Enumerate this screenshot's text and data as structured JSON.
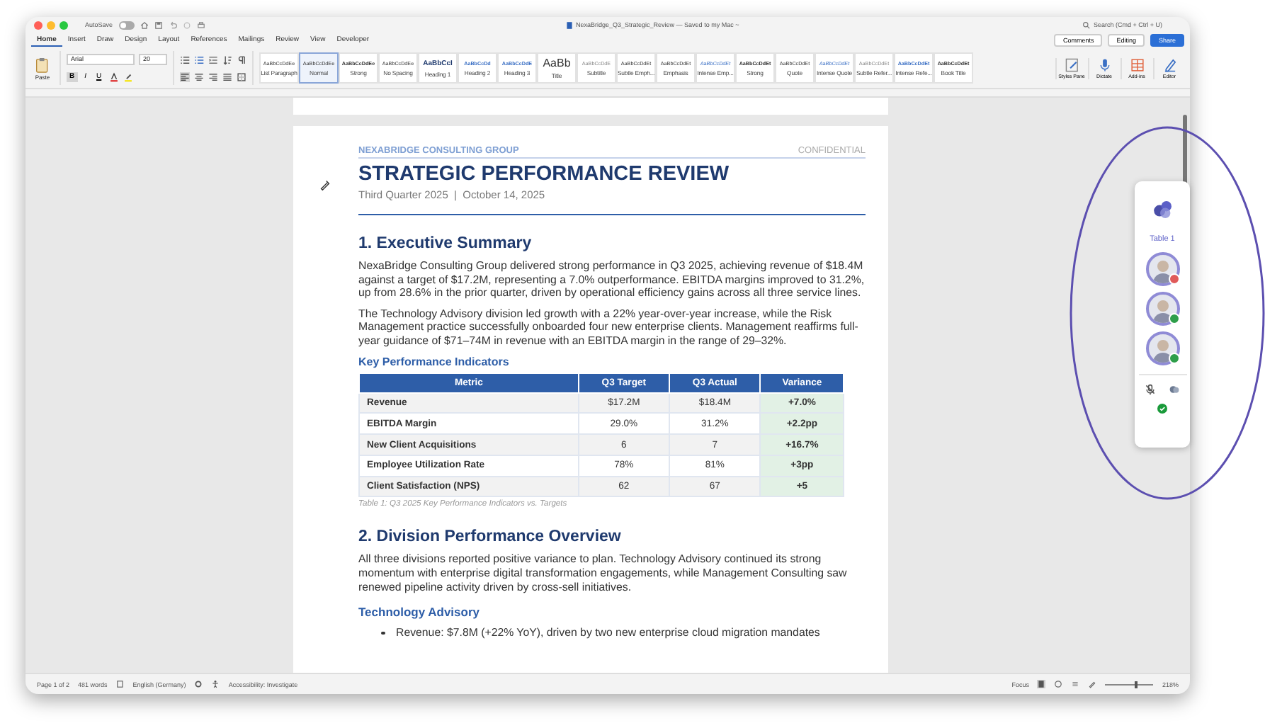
{
  "window": {
    "title": "NexaBridge_Q3_Strategic_Review — Saved to my Mac ~",
    "autosave": {
      "label": "AutoSave",
      "on": false
    }
  },
  "search": {
    "placeholder": "Search (Cmd + Ctrl + U)"
  },
  "header_buttons": [
    {
      "kind": "comments",
      "label": "Comments"
    },
    {
      "kind": "editing",
      "label": "Editing"
    },
    {
      "kind": "share",
      "label": "Share"
    }
  ],
  "tabs": [
    {
      "label": "Home",
      "selected": true
    },
    {
      "label": "Insert",
      "selected": false
    },
    {
      "label": "Draw",
      "selected": false
    },
    {
      "label": "Design",
      "selected": false
    },
    {
      "label": "Layout",
      "selected": false
    },
    {
      "label": "References",
      "selected": false
    },
    {
      "label": "Mailings",
      "selected": false
    },
    {
      "label": "Review",
      "selected": false
    },
    {
      "label": "View",
      "selected": false
    },
    {
      "label": "Developer",
      "selected": false
    }
  ],
  "ribbon": {
    "paste_label": "Paste",
    "font": "Arial",
    "size": "20",
    "format_buttons": [
      {
        "label": "B",
        "selected": true
      },
      {
        "label": "I",
        "selected": false
      },
      {
        "label": "U",
        "selected": false
      }
    ],
    "styles": [
      {
        "sample": "AaBbCcDdEe",
        "name": "List Paragraph",
        "kind": "plain",
        "selected": false
      },
      {
        "sample": "AaBbCcDdEe",
        "name": "Normal",
        "kind": "plain",
        "selected": true
      },
      {
        "sample": "AaBbCcDdEe",
        "name": "Strong",
        "kind": "bold",
        "selected": false
      },
      {
        "sample": "AaBbCcDdEe",
        "name": "No Spacing",
        "kind": "plain",
        "selected": false
      },
      {
        "sample": "AaBbCcI",
        "name": "Heading 1",
        "kind": "heading",
        "selected": false
      },
      {
        "sample": "AaBbCcDd",
        "name": "Heading 2",
        "kind": "heading2",
        "selected": false
      },
      {
        "sample": "AaBbCcDdE",
        "name": "Heading 3",
        "kind": "heading2",
        "selected": false
      },
      {
        "sample": "AaBb",
        "name": "Title",
        "kind": "title",
        "selected": false
      },
      {
        "sample": "AaBbCcDdE",
        "name": "Subtitle",
        "kind": "muted",
        "selected": false
      },
      {
        "sample": "AaBbCcDdEt",
        "name": "Subtle Emph...",
        "kind": "plain",
        "selected": false
      },
      {
        "sample": "AaBbCcDdEt",
        "name": "Emphasis",
        "kind": "plain",
        "selected": false
      },
      {
        "sample": "AaBbCcDdEt",
        "name": "Intense Emp...",
        "kind": "accent",
        "selected": false
      },
      {
        "sample": "AaBbCcDdEt",
        "name": "Strong",
        "kind": "bold",
        "selected": false
      },
      {
        "sample": "AaBbCcDdEt",
        "name": "Quote",
        "kind": "plain",
        "selected": false
      },
      {
        "sample": "AaBbCcDdEt",
        "name": "Intense Quote",
        "kind": "accent",
        "selected": false
      },
      {
        "sample": "AaBbCcDdEt",
        "name": "Subtle Refer...",
        "kind": "muted",
        "selected": false
      },
      {
        "sample": "AaBbCcDdEt",
        "name": "Intense Refe...",
        "kind": "heading2",
        "selected": false
      },
      {
        "sample": "AaBbCcDdEt",
        "name": "Book Title",
        "kind": "bold",
        "selected": false
      }
    ],
    "actions": [
      {
        "kind": "styles",
        "label": "Styles Pane"
      },
      {
        "kind": "dictate",
        "label": "Dictate"
      },
      {
        "kind": "addins",
        "label": "Add-ins"
      },
      {
        "kind": "editor",
        "label": "Editor"
      }
    ]
  },
  "document": {
    "header_left": "NEXABRIDGE CONSULTING GROUP",
    "header_right": "CONFIDENTIAL",
    "title": "STRATEGIC PERFORMANCE REVIEW",
    "subtitle": "Third Quarter 2025  |  October 14, 2025",
    "blocks": [
      {
        "kind": "h1",
        "text": "1. Executive Summary"
      },
      {
        "kind": "p",
        "text": "NexaBridge Consulting Group delivered strong performance in Q3 2025, achieving revenue of $18.4M against a target of $17.2M, representing a 7.0% outperformance. EBITDA margins improved to 31.2%, up from 28.6% in the prior quarter, driven by operational efficiency gains across all three service lines."
      },
      {
        "kind": "p",
        "text": "The Technology Advisory division led growth with a 22% year-over-year increase, while the Risk Management practice successfully onboarded four new enterprise clients. Management reaffirms full-year guidance of $71–74M in revenue with an EBITDA margin in the range of 29–32%."
      },
      {
        "kind": "h3",
        "text": "Key Performance Indicators"
      },
      {
        "kind": "table",
        "columns": [
          {
            "label": "Metric",
            "highlight": false
          },
          {
            "label": "Q3 Target",
            "highlight": false
          },
          {
            "label": "Q3 Actual",
            "highlight": false
          },
          {
            "label": "Variance",
            "highlight": true
          }
        ],
        "rows": [
          [
            "Revenue",
            "$17.2M",
            "$18.4M",
            "+7.0%"
          ],
          [
            "EBITDA Margin",
            "29.0%",
            "31.2%",
            "+2.2pp"
          ],
          [
            "New Client Acquisitions",
            "6",
            "7",
            "+16.7%"
          ],
          [
            "Employee Utilization Rate",
            "78%",
            "81%",
            "+3pp"
          ],
          [
            "Client Satisfaction (NPS)",
            "62",
            "67",
            "+5"
          ]
        ]
      },
      {
        "kind": "caption",
        "text": "Table 1: Q3 2025 Key Performance Indicators vs. Targets"
      },
      {
        "kind": "h1",
        "text": "2. Division Performance Overview"
      },
      {
        "kind": "p",
        "text": "All three divisions reported positive variance to plan. Technology Advisory continued its strong momentum with enterprise digital transformation engagements, while Management Consulting saw renewed pipeline activity driven by cross-sell initiatives."
      },
      {
        "kind": "h2",
        "text": "Technology Advisory"
      },
      {
        "kind": "bullet",
        "text": "Revenue: $7.8M (+22% YoY), driven by two new enterprise cloud migration mandates"
      }
    ]
  },
  "collab_panel": {
    "label": "Table 1",
    "participants": [
      {
        "color": "#e05a5a"
      },
      {
        "color": "#2e9e4a"
      },
      {
        "color": "#2e9e4a"
      }
    ],
    "connected": true
  },
  "status_bar": {
    "page": "Page 1 of 2",
    "words": "481 words",
    "language": "English (Germany)",
    "accessibility": "Accessibility: Investigate",
    "focus": "Focus",
    "zoom": "218%",
    "level": 0.6
  }
}
